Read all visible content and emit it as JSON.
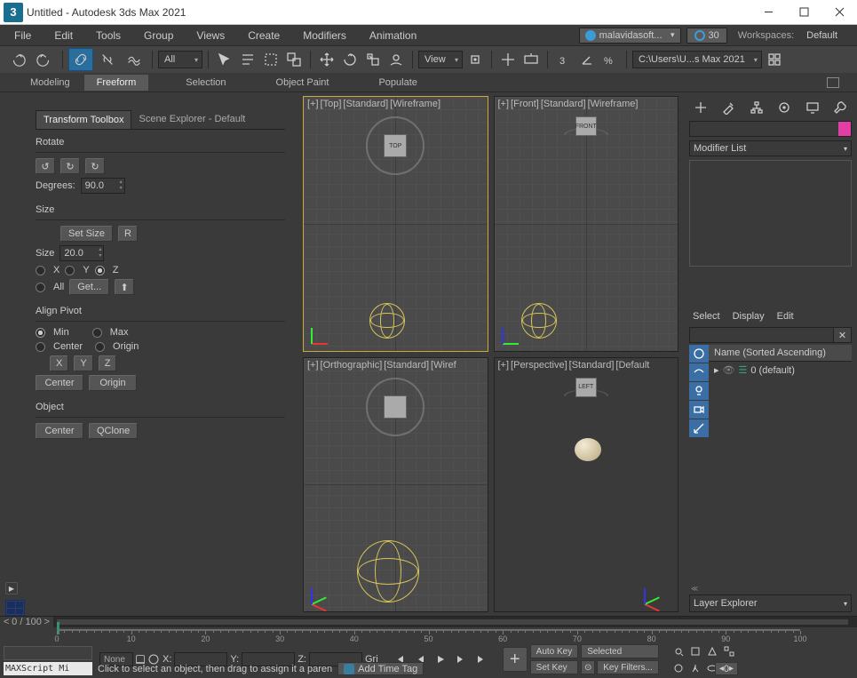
{
  "window": {
    "title": "Untitled - Autodesk 3ds Max 2021"
  },
  "menu": {
    "items": [
      "File",
      "Edit",
      "Tools",
      "Group",
      "Views",
      "Create",
      "Modifiers",
      "Animation"
    ],
    "user": "malavidasoft...",
    "clock": "30",
    "workspace_label": "Workspaces:",
    "workspace": "Default"
  },
  "toolbar": {
    "filter_dd": "All",
    "view_dd": "View",
    "path": "C:\\Users\\U...s Max 2021"
  },
  "ribbon": {
    "tabs": [
      "Modeling",
      "Freeform",
      "Selection",
      "Object Paint",
      "Populate"
    ],
    "active": 1
  },
  "panel": {
    "tabs": [
      "Transform Toolbox",
      "Scene Explorer - Default"
    ],
    "active": 0,
    "rotate": {
      "head": "Rotate",
      "deg_label": "Degrees:",
      "deg": "90.0"
    },
    "size": {
      "head": "Size",
      "set": "Set Size",
      "r": "R",
      "size_label": "Size",
      "size": "20.0",
      "axes": [
        "X",
        "Y",
        "Z"
      ],
      "all": "All",
      "get": "Get..."
    },
    "align": {
      "head": "Align Pivot",
      "opts": [
        "Min",
        "Max",
        "Center",
        "Origin"
      ],
      "btns": [
        "X",
        "Y",
        "Z"
      ],
      "center": "Center",
      "origin": "Origin"
    },
    "object": {
      "head": "Object",
      "center": "Center",
      "qclone": "QClone"
    }
  },
  "viewports": {
    "0": {
      "labels": [
        "[+]",
        "[Top]",
        "[Standard]",
        "[Wireframe]"
      ],
      "cube": "TOP"
    },
    "1": {
      "labels": [
        "[+]",
        "[Front]",
        "[Standard]",
        "[Wireframe]"
      ],
      "cube": "FRONT"
    },
    "2": {
      "labels": [
        "[+]",
        "[Orthographic]",
        "[Standard]",
        "[Wiref"
      ],
      "cube": ""
    },
    "3": {
      "labels": [
        "[+]",
        "[Perspective]",
        "[Standard]",
        "[Default"
      ],
      "cube": "LEFT"
    }
  },
  "command": {
    "mod_list": "Modifier List",
    "scene": {
      "tabs": [
        "Select",
        "Display",
        "Edit"
      ],
      "header": "Name (Sorted Ascending)",
      "item": "0 (default)"
    },
    "layer_explorer": "Layer Explorer"
  },
  "time": {
    "range": "0 / 100",
    "ticks": [
      0,
      10,
      20,
      30,
      40,
      50,
      60,
      70,
      80,
      90,
      100
    ]
  },
  "status": {
    "none": "None",
    "x": "X:",
    "y": "Y:",
    "z": "Z:",
    "grid": "Gri",
    "autokey": "Auto Key",
    "setkey": "Set Key",
    "selected": "Selected",
    "keyfilters": "Key Filters...",
    "frame": "0",
    "maxscript": "MAXScript Mi",
    "prompt": "Click to select an object, then drag to assign it a paren",
    "addtag": "Add Time Tag"
  }
}
